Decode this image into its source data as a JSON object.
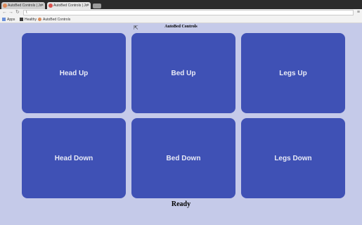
{
  "browser": {
    "tabs": [
      {
        "label": "AutoBed Controls | Jo",
        "active": false
      },
      {
        "label": "AutoBed Controls | Jo",
        "active": true
      }
    ],
    "address": "\\",
    "bookmarks": [
      "Apps",
      "Healthy",
      "AutoBed Controls"
    ]
  },
  "page": {
    "title": "AutoBed Controls",
    "buttons": [
      "Head Up",
      "Bed Up",
      "Legs Up",
      "Head Down",
      "Bed Down",
      "Legs Down"
    ],
    "status": "Ready"
  },
  "colors": {
    "page_bg": "#c5cae9",
    "button_bg": "#3f51b5",
    "button_text": "#e8eaf6"
  }
}
